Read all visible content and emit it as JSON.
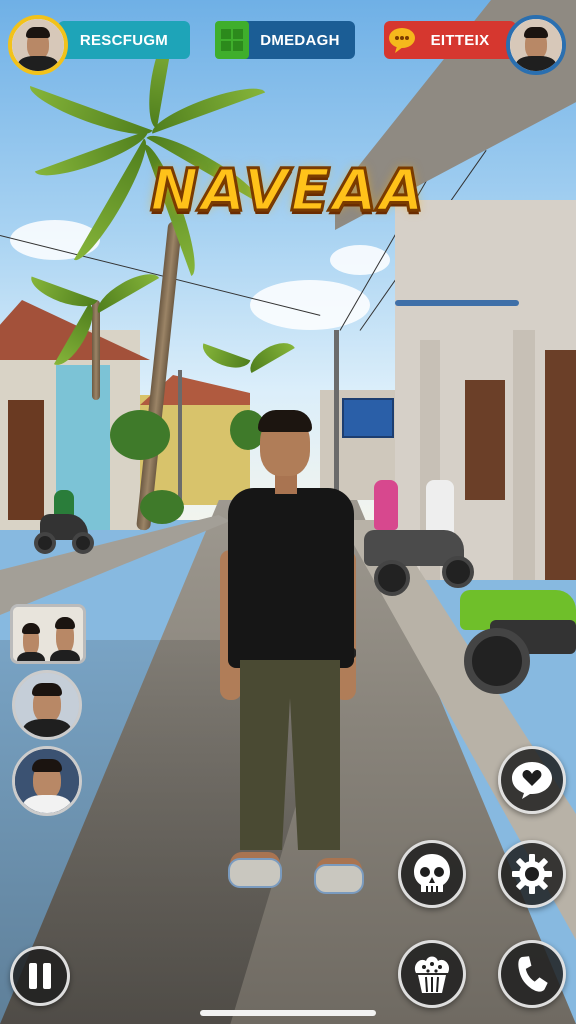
{
  "hud": {
    "player_left": {
      "name": "RESCFUGM",
      "avatar": "player-avatar",
      "color": "#1ea4b8"
    },
    "player_center": {
      "name": "DMEDAGH",
      "icon": "grid-icon",
      "color": "#1b5d95"
    },
    "player_right": {
      "name": "EITTEIX",
      "icon": "chat-bubble-icon",
      "color": "#d6372f"
    }
  },
  "title": "NAVEAA",
  "side_cams": [
    "camera-feed-1",
    "camera-feed-2",
    "camera-feed-3"
  ],
  "controls": {
    "right": [
      "heart-bubble-icon",
      "skull-icon",
      "gear-icon",
      "phone-icon",
      "muffin-icon"
    ],
    "pause": "pause-icon"
  },
  "colors": {
    "title_fill": "#ffc21a",
    "title_stroke": "#7a3b00",
    "button_bg": "#1e1e1e"
  }
}
